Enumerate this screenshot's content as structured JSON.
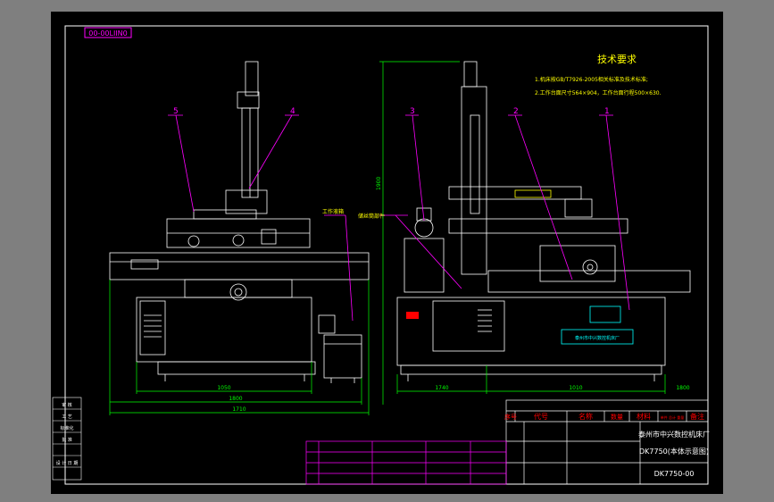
{
  "drawing": {
    "code_stamp": "00-00LIIN0",
    "tech_title": "技术要求",
    "tech_line1": "1.机床按GB/T7926-2005相关标准及技术标准;",
    "tech_line2": "2.工作台面尺寸564×904，工作台面行程500×630.",
    "callouts": [
      "5",
      "4",
      "3",
      "2",
      "1"
    ],
    "side_labels": [
      "工作液箱",
      "储丝筒部件"
    ],
    "front_dims": [
      "1050",
      "1800",
      "1710"
    ],
    "side_dims": [
      "1740",
      "1010",
      "1800"
    ],
    "vertical_dim": "1900",
    "panel_text": "泰州市中兴数控机床厂"
  },
  "title_block": {
    "header": [
      "序号",
      "代号",
      "名称",
      "数量",
      "材料",
      "单件 总计 重量",
      "备注"
    ],
    "company": "泰州市中兴数控机床厂",
    "product": "DK7750(本体示意图)",
    "drawing_no": "DK7750-00",
    "left_labels": [
      "审 核",
      "工 艺",
      "标准化",
      "批 准",
      "设 计 日 期"
    ]
  },
  "colors": {
    "background": "#000000",
    "outline": "#ffffff",
    "leader": "#ff00ff",
    "dimension": "#00ff00",
    "text_yellow": "#ffff00",
    "red": "#ff0000",
    "cyan": "#00ffff",
    "frame_grey": "#7f7f7f"
  }
}
